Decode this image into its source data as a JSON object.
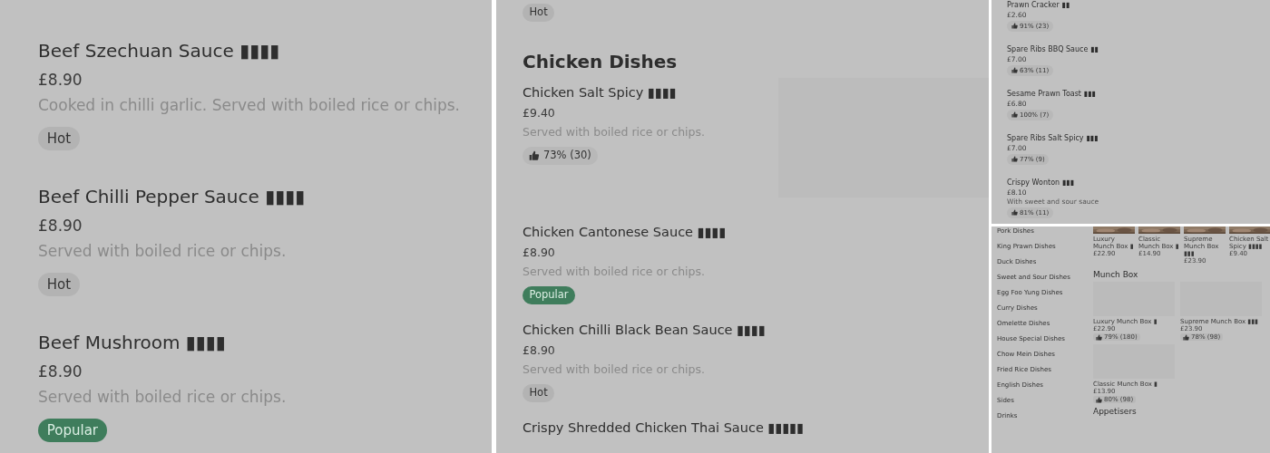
{
  "left_panel": {
    "items": [
      {
        "name": "Beef Szechuan Sauce ▮▮▮▮",
        "price": "£8.90",
        "description": "Cooked in chilli garlic. Served with boiled rice or chips.",
        "badge": {
          "kind": "hot",
          "label": "Hot"
        }
      },
      {
        "name": "Beef Chilli Pepper Sauce ▮▮▮▮",
        "price": "£8.90",
        "description": "Served with boiled rice or chips.",
        "badge": {
          "kind": "hot",
          "label": "Hot"
        }
      },
      {
        "name": "Beef Mushroom ▮▮▮▮",
        "price": "£8.90",
        "description": "Served with boiled rice or chips.",
        "badge": {
          "kind": "popular",
          "label": "Popular"
        }
      }
    ]
  },
  "middle_panel": {
    "leading_badge": {
      "kind": "hot",
      "label": "Hot"
    },
    "section_title": "Chicken Dishes",
    "items": [
      {
        "name": "Chicken Salt Spicy ▮▮▮▮",
        "price": "£9.40",
        "description": "Served with boiled rice or chips.",
        "badge": {
          "kind": "rating",
          "label": "73% (30)"
        },
        "has_image": true
      },
      {
        "name": "Chicken Cantonese Sauce ▮▮▮▮",
        "price": "£8.90",
        "description": "Served with boiled rice or chips.",
        "badge": {
          "kind": "popular",
          "label": "Popular"
        },
        "has_image": false
      },
      {
        "name": "Chicken Chilli Black Bean Sauce ▮▮▮▮",
        "price": "£8.90",
        "description": "Served with boiled rice or chips.",
        "badge": {
          "kind": "hot",
          "label": "Hot"
        },
        "has_image": false
      },
      {
        "name": "Crispy Shredded Chicken Thai Sauce ▮▮▮▮▮",
        "has_image": false
      }
    ]
  },
  "top_right_panel": {
    "items": [
      {
        "name": "Prawn Cracker ▮▮",
        "price": "£2.60",
        "badge": {
          "kind": "rating",
          "label": "91% (23)"
        }
      },
      {
        "name": "Spare Ribs BBQ Sauce ▮▮",
        "price": "£7.00",
        "badge": {
          "kind": "rating",
          "label": "63% (11)"
        }
      },
      {
        "name": "Sesame Prawn Toast ▮▮▮",
        "price": "£6.80",
        "badge": {
          "kind": "rating",
          "label": "100% (7)"
        }
      },
      {
        "name": "Spare Ribs Salt Spicy ▮▮▮",
        "price": "£7.00",
        "badge": {
          "kind": "rating",
          "label": "77% (9)"
        }
      },
      {
        "name": "Crispy Wonton ▮▮▮",
        "price": "£8.10",
        "description": "With sweet and sour sauce",
        "badge": {
          "kind": "rating",
          "label": "81% (11)"
        }
      }
    ]
  },
  "bottom_right_panel": {
    "categories": [
      "Pork Dishes",
      "King Prawn Dishes",
      "Duck Dishes",
      "Sweet and Sour Dishes",
      "Egg Foo Yung Dishes",
      "Curry Dishes",
      "Omelette Dishes",
      "House Special Dishes",
      "Chow Mein Dishes",
      "Fried Rice Dishes",
      "English Dishes",
      "Sides",
      "Drinks"
    ],
    "featured": [
      {
        "name": "Luxury Munch Box ▮",
        "price": "£22.90"
      },
      {
        "name": "Classic Munch Box ▮",
        "price": "£14.90"
      },
      {
        "name": "Supreme Munch Box ▮▮▮",
        "price": "£23.90"
      },
      {
        "name": "Chicken Salt Spicy ▮▮▮▮",
        "price": "£9.40"
      }
    ],
    "section_title": "Munch Box",
    "cards": [
      {
        "name": "Luxury Munch Box ▮",
        "price": "£22.90",
        "rating": "79% (180)"
      },
      {
        "name": "Supreme Munch Box ▮▮▮",
        "price": "£23.90",
        "rating": "78% (98)"
      },
      {
        "name": "Classic Munch Box ▮",
        "price": "£13.90",
        "rating": "80% (98)"
      }
    ],
    "next_section_title": "Appetisers"
  }
}
